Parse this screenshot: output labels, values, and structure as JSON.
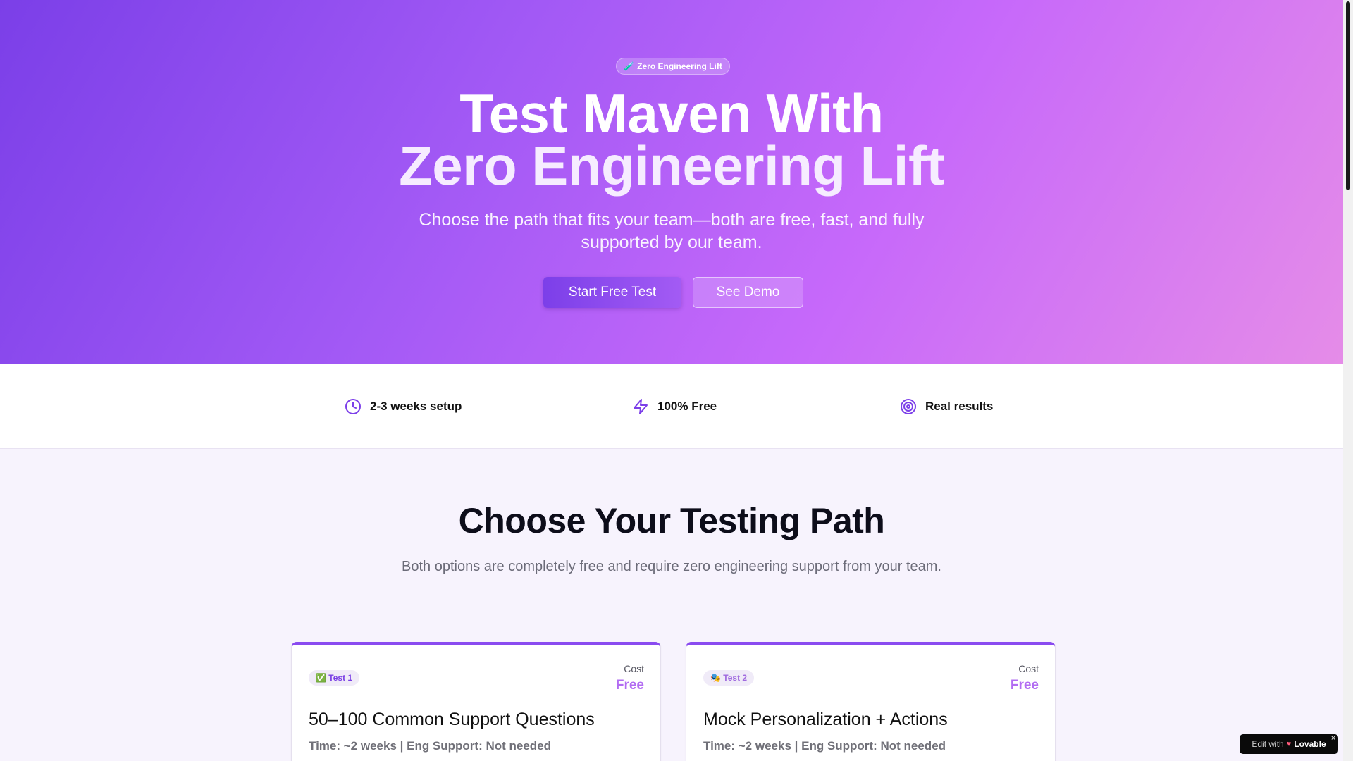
{
  "hero": {
    "badge_icon": "🧪",
    "badge_text": "Zero Engineering Lift",
    "title_line1": "Test Maven With",
    "title_line2": "Zero Engineering Lift",
    "subtitle": "Choose the path that fits your team—both are free, fast, and fully supported by our team.",
    "primary_button": "Start Free Test",
    "secondary_button": "See Demo"
  },
  "features": [
    {
      "icon": "clock-icon",
      "label": "2-3 weeks setup"
    },
    {
      "icon": "lightning-icon",
      "label": "100% Free"
    },
    {
      "icon": "target-icon",
      "label": "Real results"
    }
  ],
  "section": {
    "title": "Choose Your Testing Path",
    "subtitle": "Both options are completely free and require zero engineering support from your team."
  },
  "cards": [
    {
      "tag_icon": "✅",
      "tag": "Test 1",
      "cost_label": "Cost",
      "cost_value": "Free",
      "title": "50–100 Common Support Questions",
      "meta": "Time: ~2 weeks | Eng Support: Not needed"
    },
    {
      "tag_icon": "🎭",
      "tag": "Test 2",
      "cost_label": "Cost",
      "cost_value": "Free",
      "title": "Mock Personalization + Actions",
      "meta": "Time: ~2 weeks | Eng Support: Not needed"
    }
  ],
  "edit_badge": {
    "prefix": "Edit with",
    "brand": "Lovable",
    "close": "×"
  },
  "colors": {
    "accent": "#8a4bf0",
    "cost": "#b26cf2",
    "hero_start": "#7b3fe8",
    "hero_end": "#e58ce8"
  }
}
